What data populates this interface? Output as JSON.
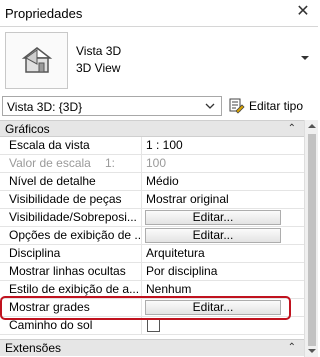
{
  "panel": {
    "title": "Propriedades"
  },
  "type_selector": {
    "family": "Vista 3D",
    "type": "3D View",
    "thumbnail_icon": "house-3d-icon"
  },
  "instance_selector": {
    "value": "Vista 3D: {3D}",
    "edit_type_label": "Editar tipo"
  },
  "groups": {
    "graficos": {
      "label": "Gráficos",
      "collapse_glyph": "»"
    },
    "extensoes": {
      "label": "Extensões",
      "collapse_glyph": "»"
    }
  },
  "rows": [
    {
      "name": "Escala da vista",
      "value": "1 : 100"
    },
    {
      "name": "Valor de escala",
      "suffix": "1:",
      "value": "100",
      "disabled": true
    },
    {
      "name": "Nível de detalhe",
      "value": "Médio"
    },
    {
      "name": "Visibilidade de peças",
      "value": "Mostrar original"
    },
    {
      "name": "Visibilidade/Sobreposi...",
      "button": "Editar..."
    },
    {
      "name": "Opções de exibição de ...",
      "button": "Editar..."
    },
    {
      "name": "Disciplina",
      "value": "Arquitetura"
    },
    {
      "name": "Mostrar linhas ocultas",
      "value": "Por disciplina"
    },
    {
      "name": "Estilo de exibição de a...",
      "value": "Nenhum"
    },
    {
      "name": "Mostrar grades",
      "button": "Editar...",
      "highlighted": true
    },
    {
      "name": "Caminho do sol",
      "checkbox": false
    }
  ],
  "colors": {
    "highlight": "#c0121e",
    "group_bg": "#e6e6e6",
    "disabled_text": "#9a9a9a"
  }
}
